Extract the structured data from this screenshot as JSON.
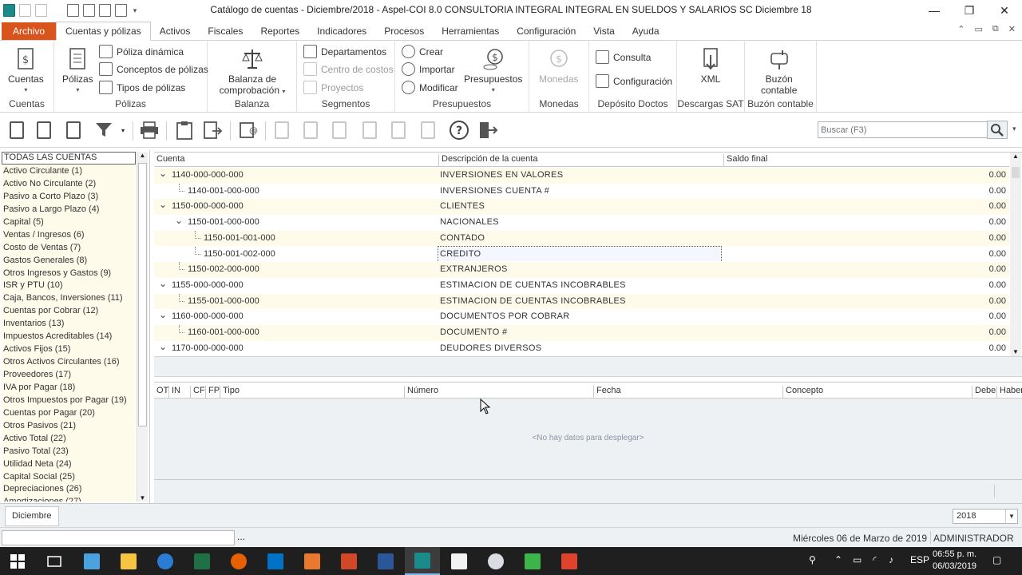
{
  "window": {
    "title": "Catálogo de cuentas - Diciembre/2018 - Aspel-COI 8.0 CONSULTORIA INTEGRAL INTEGRAL EN SUELDOS Y SALARIOS SC Diciembre 18",
    "controls": [
      "—",
      "❐",
      "✕"
    ]
  },
  "ribbon_tabs": [
    "Archivo",
    "Cuentas y pólizas",
    "Activos",
    "Fiscales",
    "Reportes",
    "Indicadores",
    "Procesos",
    "Herramientas",
    "Configuración",
    "Vista",
    "Ayuda"
  ],
  "ribbon": {
    "cuentas": {
      "button": "Cuentas",
      "group": "Cuentas"
    },
    "polizas": {
      "button": "Pólizas",
      "items": [
        "Póliza dinámica",
        "Conceptos de pólizas",
        "Tipos de pólizas"
      ],
      "group": "Pólizas"
    },
    "balanza": {
      "button_line1": "Balanza de",
      "button_line2": "comprobación",
      "group": "Balanza"
    },
    "segmentos": {
      "items": [
        "Departamentos",
        "Centro de costos",
        "Proyectos"
      ],
      "group": "Segmentos"
    },
    "presupuestos": {
      "items": [
        "Crear",
        "Importar",
        "Modificar"
      ],
      "button": "Presupuestos",
      "group": "Presupuestos"
    },
    "monedas": {
      "button": "Monedas",
      "group": "Monedas"
    },
    "deposito": {
      "items": [
        "Consulta",
        "Configuración"
      ],
      "group": "Depósito Doctos"
    },
    "descargas": {
      "button": "XML",
      "group": "Descargas SAT"
    },
    "buzon": {
      "button_line1": "Buzón",
      "button_line2": "contable",
      "group": "Buzón contable"
    }
  },
  "search": {
    "placeholder": "Buscar (F3)"
  },
  "left_panel": {
    "items": [
      "TODAS LAS CUENTAS",
      "Activo Circulante (1)",
      "Activo No Circulante (2)",
      "Pasivo a Corto Plazo (3)",
      "Pasivo a Largo Plazo (4)",
      "Capital (5)",
      "Ventas / Ingresos (6)",
      "Costo de Ventas (7)",
      "Gastos Generales (8)",
      "Otros Ingresos y Gastos (9)",
      "ISR y PTU (10)",
      "Caja, Bancos, Inversiones (11)",
      "Cuentas por Cobrar (12)",
      "Inventarios (13)",
      "Impuestos Acreditables (14)",
      "Activos Fijos (15)",
      "Otros Activos Circulantes (16)",
      "Proveedores (17)",
      "IVA por Pagar (18)",
      "Otros Impuestos por Pagar (19)",
      "Cuentas por Pagar (20)",
      "Otros Pasivos (21)",
      "Activo Total (22)",
      "Pasivo Total (23)",
      "Utilidad Neta (24)",
      "Capital Social (25)",
      "Depreciaciones (26)",
      "Amortizaciones (27)"
    ]
  },
  "accounts_grid": {
    "columns": [
      "Cuenta",
      "Descripción de la cuenta",
      "Saldo final"
    ],
    "rows": [
      {
        "code": "1140-000-000-000",
        "desc": "INVERSIONES EN VALORES",
        "bal": "0.00",
        "level": 0,
        "expandable": true
      },
      {
        "code": "1140-001-000-000",
        "desc": "INVERSIONES CUENTA #",
        "bal": "0.00",
        "level": 1,
        "expandable": false
      },
      {
        "code": "1150-000-000-000",
        "desc": "CLIENTES",
        "bal": "0.00",
        "level": 0,
        "expandable": true
      },
      {
        "code": "1150-001-000-000",
        "desc": "NACIONALES",
        "bal": "0.00",
        "level": 1,
        "expandable": true
      },
      {
        "code": "1150-001-001-000",
        "desc": "CONTADO",
        "bal": "0.00",
        "level": 2,
        "expandable": false
      },
      {
        "code": "1150-001-002-000",
        "desc": "CREDITO",
        "bal": "0.00",
        "level": 2,
        "expandable": false,
        "selected": true
      },
      {
        "code": "1150-002-000-000",
        "desc": "EXTRANJEROS",
        "bal": "0.00",
        "level": 1,
        "expandable": false
      },
      {
        "code": "1155-000-000-000",
        "desc": "ESTIMACION DE CUENTAS INCOBRABLES",
        "bal": "0.00",
        "level": 0,
        "expandable": true
      },
      {
        "code": "1155-001-000-000",
        "desc": "ESTIMACION DE CUENTAS INCOBRABLES",
        "bal": "0.00",
        "level": 1,
        "expandable": false
      },
      {
        "code": "1160-000-000-000",
        "desc": "DOCUMENTOS POR COBRAR",
        "bal": "0.00",
        "level": 0,
        "expandable": true
      },
      {
        "code": "1160-001-000-000",
        "desc": "DOCUMENTO #",
        "bal": "0.00",
        "level": 1,
        "expandable": false
      },
      {
        "code": "1170-000-000-000",
        "desc": "DEUDORES DIVERSOS",
        "bal": "0.00",
        "level": 0,
        "expandable": true
      }
    ]
  },
  "movements_grid": {
    "columns": [
      "OT",
      "IN",
      "CF",
      "FP",
      "Tipo",
      "Número",
      "Fecha",
      "Concepto",
      "Debe",
      "Haber"
    ],
    "empty_text": "<No hay datos para desplegar>"
  },
  "period": {
    "tab": "Diciembre",
    "year": "2018"
  },
  "status": {
    "date": "Miércoles 06 de Marzo de 2019",
    "user": "ADMINISTRADOR",
    "dots": "..."
  },
  "taskbar": {
    "lang": "ESP",
    "time": "06:55 p. m.",
    "date": "06/03/2019"
  }
}
